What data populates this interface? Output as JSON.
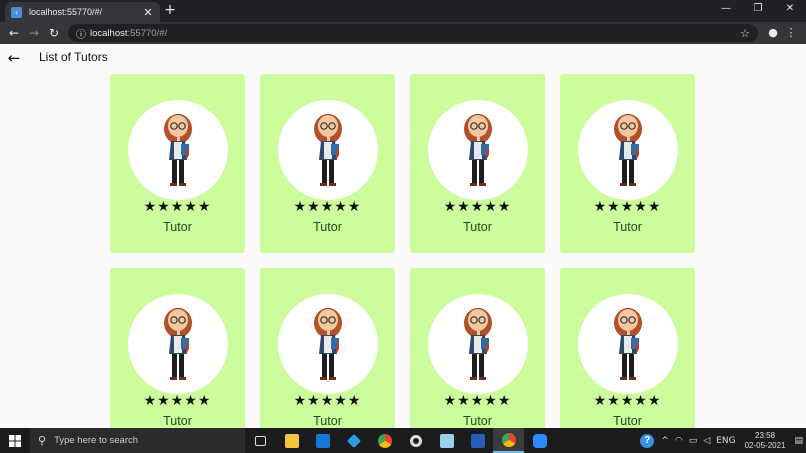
{
  "browser": {
    "tab_title": "localhost:55770/#/",
    "favicon_glyph": "‹",
    "close_glyph": "✕",
    "newtab_glyph": "+",
    "url_host": "localhost",
    "url_rest": ":55770/#/",
    "window_controls": [
      "—",
      "❐",
      "✕"
    ]
  },
  "page": {
    "title": "List of Tutors",
    "cards": [
      {
        "label": "Tutor",
        "stars": "★★★★★"
      },
      {
        "label": "Tutor",
        "stars": "★★★★★"
      },
      {
        "label": "Tutor",
        "stars": "★★★★★"
      },
      {
        "label": "Tutor",
        "stars": "★★★★★"
      },
      {
        "label": "Tutor",
        "stars": "★★★★★"
      },
      {
        "label": "Tutor",
        "stars": "★★★★★"
      },
      {
        "label": "Tutor",
        "stars": "★★★★★"
      },
      {
        "label": "Tutor",
        "stars": "★★★★★"
      }
    ]
  },
  "taskbar": {
    "search_placeholder": "Type here to search",
    "language": "ENG",
    "time": "23:58",
    "date": "02-05-2021"
  },
  "colors": {
    "card_bg": "#ccfc9c",
    "page_bg": "#fafafa",
    "accent": "#76b9ed"
  }
}
